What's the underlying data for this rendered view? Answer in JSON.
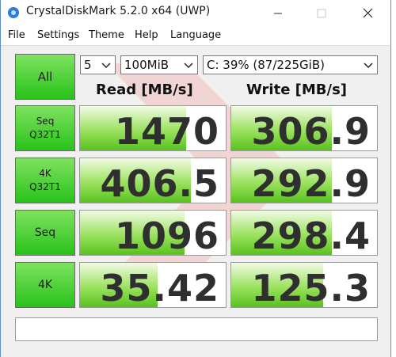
{
  "window": {
    "title": "CrystalDiskMark 5.2.0 x64 (UWP)"
  },
  "menu": [
    "File",
    "Settings",
    "Theme",
    "Help",
    "Language"
  ],
  "controls": {
    "all_label": "All",
    "count": "5",
    "size": "100MiB",
    "drive": "C: 39% (87/225GiB)"
  },
  "headers": {
    "read": "Read [MB/s]",
    "write": "Write [MB/s]"
  },
  "rows": [
    {
      "line1": "Seq",
      "line2": "Q32T1",
      "read": "1470",
      "write": "306.9",
      "read_fill": 0.73,
      "write_fill": 0.69
    },
    {
      "line1": "4K",
      "line2": "Q32T1",
      "read": "406.5",
      "write": "292.9",
      "read_fill": 0.76,
      "write_fill": 0.69
    },
    {
      "line1": "Seq",
      "line2": "",
      "read": "1096",
      "write": "298.4",
      "read_fill": 0.72,
      "write_fill": 0.69
    },
    {
      "line1": "4K",
      "line2": "",
      "read": "35.42",
      "write": "125.3",
      "read_fill": 0.53,
      "write_fill": 0.63
    }
  ],
  "colors": {
    "button_green": "#28c21a",
    "bar_green": "#58c21f"
  },
  "icons": {
    "app": "crystaldiskmark-icon",
    "minimize": "minimize-icon",
    "maximize": "maximize-icon",
    "close": "close-icon",
    "dropdown": "chevron-down-icon"
  }
}
